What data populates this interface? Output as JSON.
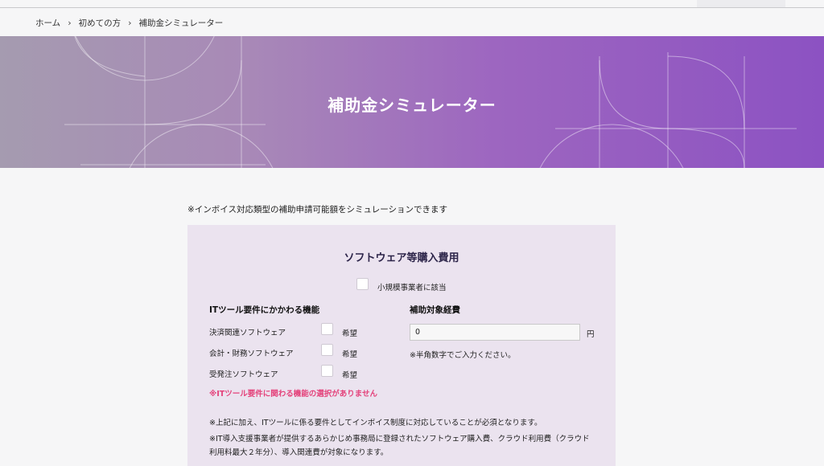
{
  "breadcrumb": {
    "home": "ホーム",
    "first_time": "初めての方",
    "current": "補助金シミュレーター"
  },
  "hero": {
    "title": "補助金シミュレーター"
  },
  "intro": "※インボイス対応類型の補助申請可能額をシミュレーションできます",
  "panel": {
    "title": "ソフトウェア等購入費用",
    "small_business_label": "小規模事業者に該当",
    "features_heading": "ITツール要件にかかわる機能",
    "features": [
      {
        "label": "決済関連ソフトウェア",
        "option": "希望"
      },
      {
        "label": "会計・財務ソフトウェア",
        "option": "希望"
      },
      {
        "label": "受発注ソフトウェア",
        "option": "希望"
      }
    ],
    "warning": "※ITツール要件に関わる機能の選択がありません",
    "expense_heading": "補助対象経費",
    "amount_value": "0",
    "amount_unit": "円",
    "amount_hint": "※半角数字でご入力ください。",
    "note1": "※上記に加え、ITツールに係る要件としてインボイス制度に対応していることが必須となります。",
    "note2_line1": "※IT導入支援事業者が提供するあらかじめ事務局に登録されたソフトウェア購入費、クラウド利用費（クラウド",
    "note2_line2": "利用料最大２年分）、導入関連費が対象になります。"
  },
  "colors": {
    "hero_start": "#a59bb0",
    "hero_end": "#8c52c2",
    "panel_bg": "#ebe3ef",
    "warning": "#e4417a"
  }
}
